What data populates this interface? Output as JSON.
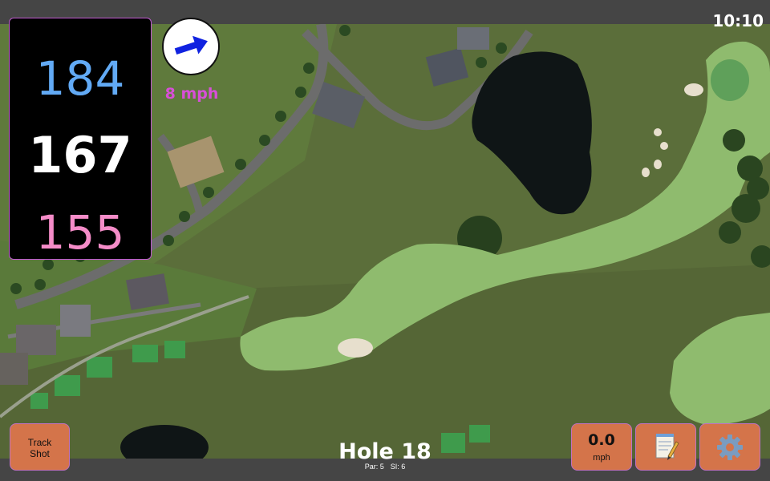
{
  "status_bar": {
    "time": "10:10"
  },
  "distances": {
    "back": "184",
    "middle": "167",
    "front": "155"
  },
  "wind": {
    "speed": "8 mph",
    "direction_icon": "arrow-right-icon",
    "arrow_color": "#1022e0"
  },
  "buttons": {
    "track_shot": "Track\nShot",
    "speed_value": "0.0",
    "speed_unit": "mph",
    "notes_icon": "notepad-icon",
    "settings_icon": "gear-icon"
  },
  "hole": {
    "title": "Hole 18",
    "par": "Par: 5",
    "stroke_index": "SI: 6"
  },
  "colors": {
    "back_distance": "#62aaf5",
    "middle_distance": "#ffffff",
    "front_distance": "#f58cc8",
    "wind_text": "#d84fd8",
    "button_bg": "#d4744a",
    "button_border": "#c070c0"
  }
}
